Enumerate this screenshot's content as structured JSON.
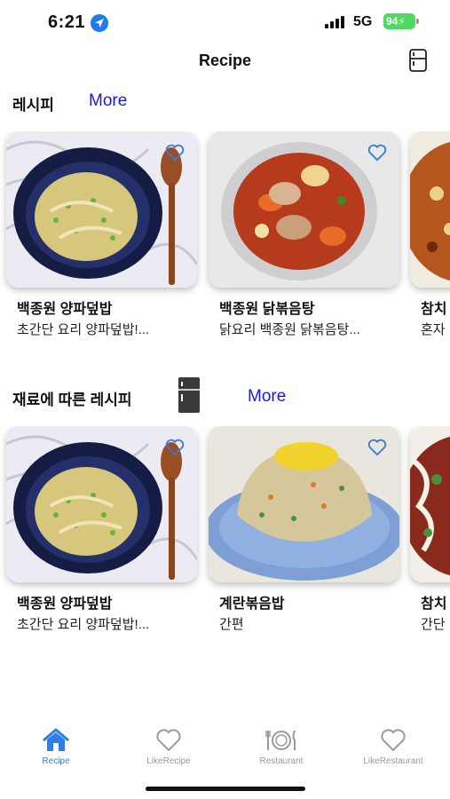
{
  "status_bar": {
    "time": "6:21",
    "network": "5G",
    "battery": "94"
  },
  "header": {
    "title": "Recipe"
  },
  "section_recipes": {
    "title": "레시피",
    "more": "More",
    "cards": [
      {
        "title": "백종원 양파덮밥",
        "desc": "초간단 요리 양파덮밥!..."
      },
      {
        "title": "백종원 닭볶음탕",
        "desc": "닭요리 백종원 닭볶음탕..."
      },
      {
        "title": "참치",
        "desc": "혼자"
      }
    ]
  },
  "section_ingredients": {
    "title": "재료에 따른 레시피",
    "more": "More",
    "cards": [
      {
        "title": "백종원 양파덮밥",
        "desc": "초간단 요리 양파덮밥!..."
      },
      {
        "title": "계란볶음밥",
        "desc": "간편"
      },
      {
        "title": "참치",
        "desc": "간단"
      }
    ]
  },
  "tabs": [
    {
      "label": "Recipe",
      "icon": "home-icon",
      "active": true
    },
    {
      "label": "LikeRecipe",
      "icon": "heart-icon",
      "active": false
    },
    {
      "label": "Restaurant",
      "icon": "dining-icon",
      "active": false
    },
    {
      "label": "LikeRestaurant",
      "icon": "heart-icon",
      "active": false
    }
  ],
  "colors": {
    "accent": "#1a1adf",
    "tab_active": "#2f7de6",
    "battery": "#4cd964"
  }
}
